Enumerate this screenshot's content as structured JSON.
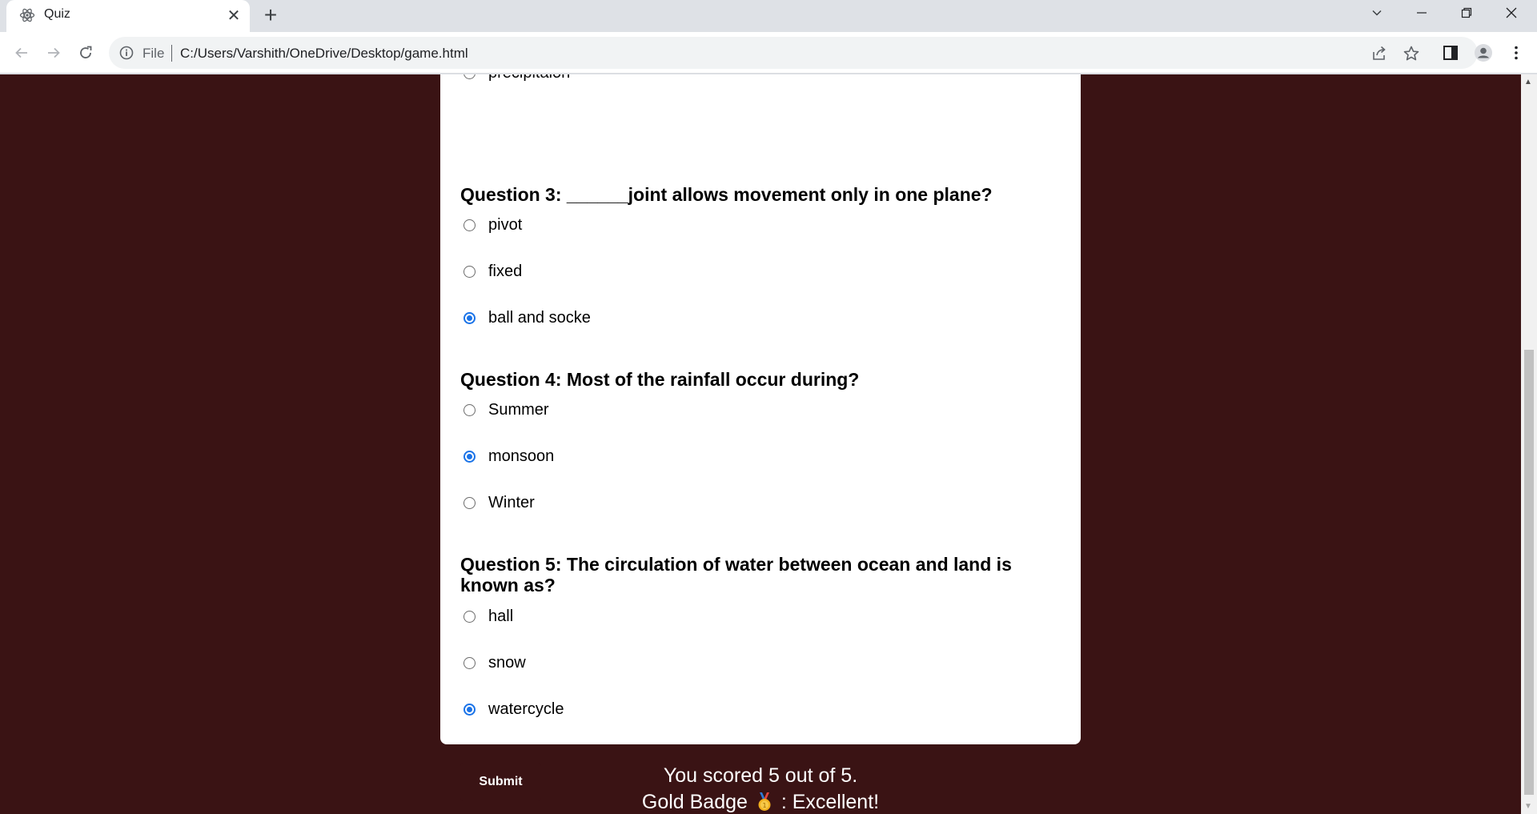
{
  "browser": {
    "tab_title": "Quiz",
    "address_scheme": "File",
    "address_url": "C:/Users/Varshith/OneDrive/Desktop/game.html"
  },
  "quiz": {
    "partial_option": "precipitaion",
    "questions": [
      {
        "title": "Question 3: ______joint allows movement only in one plane?",
        "options": [
          {
            "label": "pivot",
            "checked": false
          },
          {
            "label": "fixed",
            "checked": false
          },
          {
            "label": "ball and socke",
            "checked": true
          }
        ]
      },
      {
        "title": "Question 4: Most of the rainfall occur during?",
        "options": [
          {
            "label": "Summer",
            "checked": false
          },
          {
            "label": "monsoon",
            "checked": true
          },
          {
            "label": "Winter",
            "checked": false
          }
        ]
      },
      {
        "title": "Question 5: The circulation of water between ocean and land is known as?",
        "options": [
          {
            "label": "hall",
            "checked": false
          },
          {
            "label": "snow",
            "checked": false
          },
          {
            "label": "watercycle",
            "checked": true
          }
        ]
      }
    ],
    "submit_label": "Submit"
  },
  "result": {
    "score_text": "You scored 5 out of 5.",
    "badge_prefix": "Gold Badge",
    "badge_suffix": ": Excellent!",
    "badge_icon": "gold-medal-icon"
  },
  "colors": {
    "page_background": "#3a1314",
    "card_background": "#ffffff",
    "radio_checked": "#1a73e8"
  }
}
